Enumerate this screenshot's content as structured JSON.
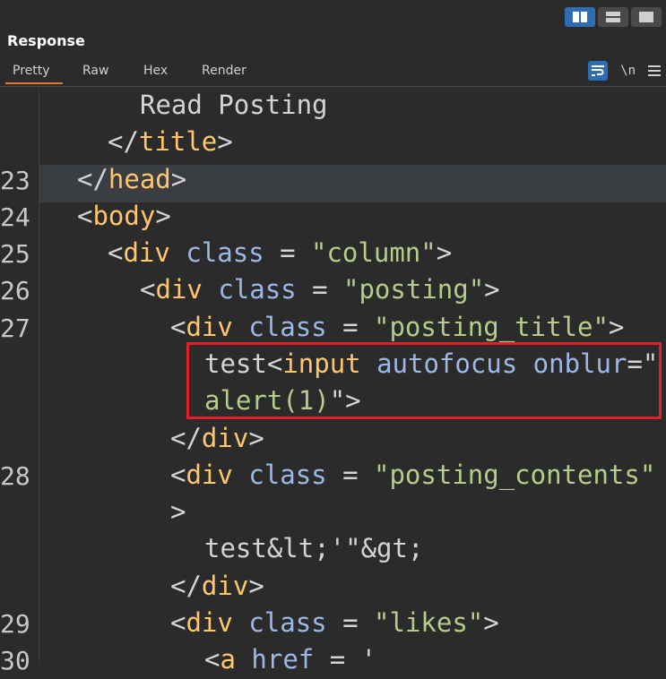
{
  "response_title": "Response",
  "tabs": [
    {
      "label": "Pretty",
      "active": true
    },
    {
      "label": "Raw",
      "active": false
    },
    {
      "label": "Hex",
      "active": false
    },
    {
      "label": "Render",
      "active": false
    }
  ],
  "toolbar": {
    "newline_label": "\\n"
  },
  "line_numbers": [
    "23",
    "24",
    "25",
    "26",
    "27",
    "28",
    "29",
    "30"
  ],
  "code": {
    "l0": "Read Posting",
    "l1_open": "</",
    "l1_tag": "title",
    "l1_close": ">",
    "l2_open": "</",
    "l2_tag": "head",
    "l2_close": ">",
    "l3_open": "<",
    "l3_tag": "body",
    "l3_close": ">",
    "l4_open": "<",
    "l4_tag": "div",
    "l4_attr": " class",
    "l4_eq": " = ",
    "l4_val": "\"column\"",
    "l4_close": ">",
    "l5_open": "<",
    "l5_tag": "div",
    "l5_attr": " class",
    "l5_eq": " = ",
    "l5_val": "\"posting\"",
    "l5_close": ">",
    "l6_open": "<",
    "l6_tag": "div",
    "l6_attr": " class",
    "l6_eq": " = ",
    "l6_val": "\"posting_title\"",
    "l6_close": ">",
    "l7_text": "test",
    "l7_open": "<",
    "l7_tag": "input",
    "l7_attr": " autofocus onblur",
    "l7_eq": "=\"",
    "l8_val": "alert(1)",
    "l8_q": "\"",
    "l8_close": ">",
    "l9_open": "</",
    "l9_tag": "div",
    "l9_close": ">",
    "l10_open": "<",
    "l10_tag": "div",
    "l10_attr": " class",
    "l10_eq": " = ",
    "l10_val": "\"posting_contents\"",
    "l11_close": ">",
    "l12_text": "test&lt;'\"&gt;",
    "l13_open": "</",
    "l13_tag": "div",
    "l13_close": ">",
    "l14_open": "<",
    "l14_tag": "div",
    "l14_attr": " class",
    "l14_eq": " = ",
    "l14_val": "\"likes\"",
    "l14_close": ">",
    "l15_open": "<",
    "l15_tag": "a",
    "l15_attr": " href",
    "l15_eq": " = ",
    "l15_val": "'"
  },
  "colors": {
    "tag": "#ffc66d",
    "attribute": "#9cb8e6",
    "string": "#b5cc8a",
    "highlight_border": "#e0202a",
    "accent": "#2f6db3",
    "active_tab_underline": "#e8732a"
  }
}
